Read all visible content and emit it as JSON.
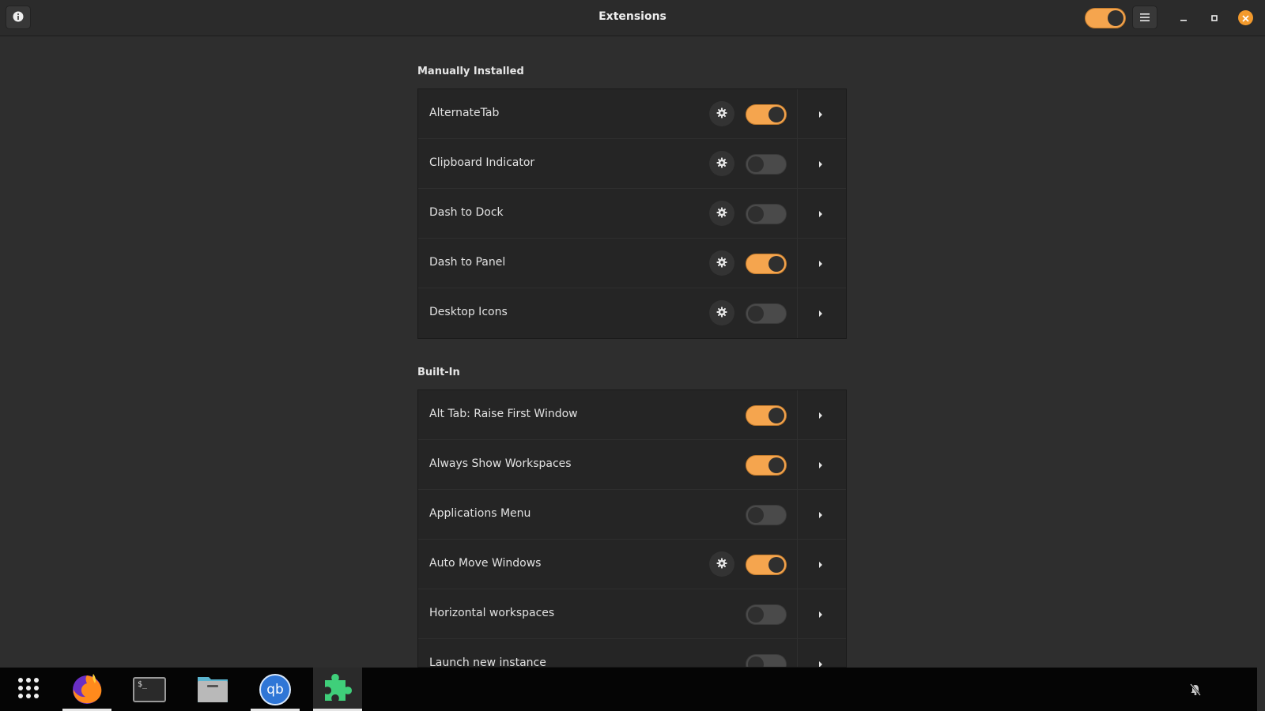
{
  "window": {
    "title": "Extensions",
    "info_icon": "info-icon",
    "global_toggle_on": true,
    "menu_icon": "hamburger-menu-icon",
    "minimize_icon": "minimize-icon",
    "maximize_icon": "maximize-icon",
    "close_icon": "close-icon"
  },
  "sections": {
    "manual": {
      "title": "Manually Installed",
      "items": [
        {
          "label": "AlternateTab",
          "enabled": true,
          "has_settings": true
        },
        {
          "label": "Clipboard Indicator",
          "enabled": false,
          "has_settings": true
        },
        {
          "label": "Dash to Dock",
          "enabled": false,
          "has_settings": true
        },
        {
          "label": "Dash to Panel",
          "enabled": true,
          "has_settings": true
        },
        {
          "label": "Desktop Icons",
          "enabled": false,
          "has_settings": true
        }
      ]
    },
    "builtin": {
      "title": "Built-In",
      "items": [
        {
          "label": "Alt Tab: Raise First Window",
          "enabled": true,
          "has_settings": false
        },
        {
          "label": "Always Show Workspaces",
          "enabled": true,
          "has_settings": false
        },
        {
          "label": "Applications Menu",
          "enabled": false,
          "has_settings": false
        },
        {
          "label": "Auto Move Windows",
          "enabled": true,
          "has_settings": true
        },
        {
          "label": "Horizontal workspaces",
          "enabled": false,
          "has_settings": false
        },
        {
          "label": "Launch new instance",
          "enabled": false,
          "has_settings": false
        }
      ]
    }
  },
  "taskbar": {
    "apps": [
      {
        "name": "app-grid-icon",
        "active": false
      },
      {
        "name": "firefox-icon",
        "active": true
      },
      {
        "name": "terminal-icon",
        "active": false,
        "text": "$_"
      },
      {
        "name": "files-icon",
        "active": false
      },
      {
        "name": "qbittorrent-icon",
        "active": true,
        "text": "qb"
      },
      {
        "name": "extensions-icon",
        "active": true
      }
    ],
    "tray_icons": [
      "notifications-off-icon"
    ]
  },
  "colors": {
    "accent": "#f5a54e",
    "close": "#f39a2c",
    "background": "#2e2e2e",
    "list_bg": "#252525",
    "extensions_green": "#3fcf7a"
  }
}
